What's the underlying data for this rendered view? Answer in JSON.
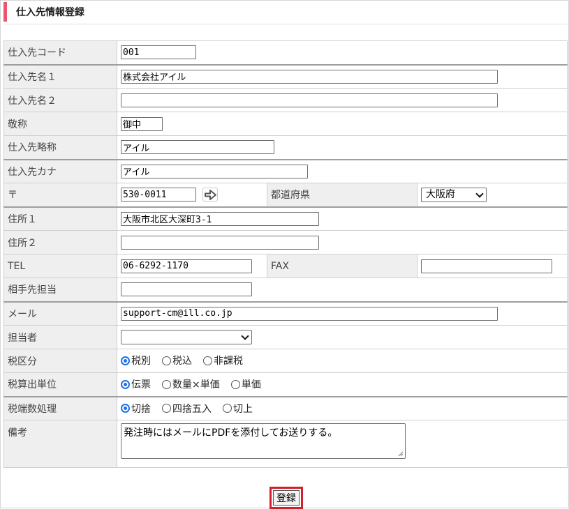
{
  "page": {
    "title": "仕入先情報登録",
    "accent_color": "#e8576e"
  },
  "fields": {
    "code": {
      "label": "仕入先コード",
      "value": "001"
    },
    "name1": {
      "label": "仕入先名１",
      "value": "株式会社アイル"
    },
    "name2": {
      "label": "仕入先名２",
      "value": ""
    },
    "honorific": {
      "label": "敬称",
      "value": "御中"
    },
    "short_name": {
      "label": "仕入先略称",
      "value": "アイル"
    },
    "kana": {
      "label": "仕入先カナ",
      "value": "アイル"
    },
    "postal": {
      "label": "〒",
      "value": "530-0011",
      "lookup_icon": "arrow-right-icon"
    },
    "prefecture": {
      "label": "都道府県",
      "value": "大阪府"
    },
    "address1": {
      "label": "住所１",
      "value": "大阪市北区大深町3-1"
    },
    "address2": {
      "label": "住所２",
      "value": ""
    },
    "tel": {
      "label": "TEL",
      "value": "06-6292-1170"
    },
    "fax": {
      "label": "FAX",
      "value": ""
    },
    "contact": {
      "label": "相手先担当",
      "value": ""
    },
    "email": {
      "label": "メール",
      "value": "support-cm@ill.co.jp"
    },
    "staff": {
      "label": "担当者",
      "value": ""
    },
    "tax_type": {
      "label": "税区分",
      "options": [
        "税別",
        "税込",
        "非課税"
      ],
      "selected": "税別"
    },
    "tax_calc_unit": {
      "label": "税算出単位",
      "options": [
        "伝票",
        "数量×単価",
        "単価"
      ],
      "selected": "伝票"
    },
    "tax_rounding": {
      "label": "税端数処理",
      "options": [
        "切捨",
        "四捨五入",
        "切上"
      ],
      "selected": "切捨"
    },
    "memo": {
      "label": "備考",
      "value": "発注時にはメールにPDFを添付してお送りする。"
    }
  },
  "actions": {
    "submit_label": "登録",
    "submit_highlight_color": "#d21f2b"
  }
}
